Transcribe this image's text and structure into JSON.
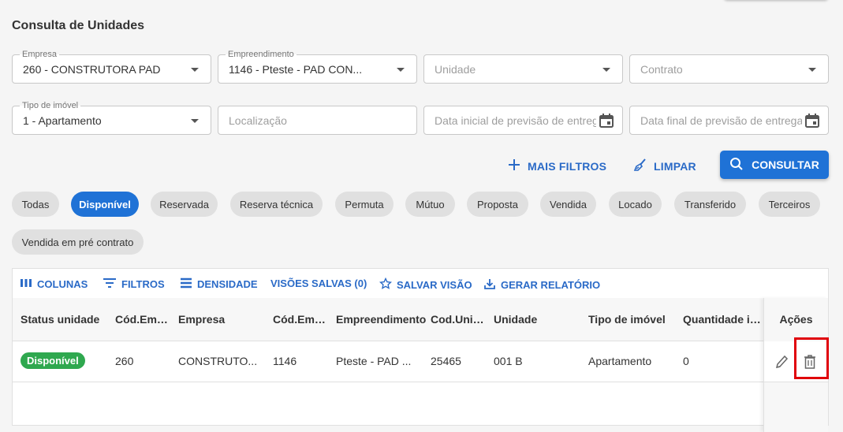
{
  "page": {
    "title": "Consulta de Unidades"
  },
  "filters": {
    "empresa": {
      "label": "Empresa",
      "value": "260 - CONSTRUTORA PAD"
    },
    "empreendimento": {
      "label": "Empreendimento",
      "value": "1146 - Pteste - PAD CON..."
    },
    "unidade": {
      "placeholder": "Unidade"
    },
    "contrato": {
      "placeholder": "Contrato"
    },
    "tipo_imovel": {
      "label": "Tipo de imóvel",
      "value": "1 - Apartamento"
    },
    "localizacao": {
      "placeholder": "Localização"
    },
    "data_inicial": {
      "placeholder": "Data inicial de previsão de entrega"
    },
    "data_final": {
      "placeholder": "Data final de previsão de entrega"
    }
  },
  "actions": {
    "more_filters": "MAIS FILTROS",
    "clear": "LIMPAR",
    "search": "CONSULTAR"
  },
  "status_chips": [
    "Todas",
    "Disponível",
    "Reservada",
    "Reserva técnica",
    "Permuta",
    "Mútuo",
    "Proposta",
    "Vendida",
    "Locado",
    "Transferido",
    "Terceiros",
    "Vendida em pré contrato"
  ],
  "active_chip": "Disponível",
  "toolbar": {
    "columns": "COLUNAS",
    "filters": "FILTROS",
    "density": "DENSIDADE",
    "saved_views": "VISÕES SALVAS (0)",
    "save_view": "SALVAR VISÃO",
    "report": "GERAR RELATÓRIO"
  },
  "table": {
    "headers": [
      "Status unidade",
      "Cód.Emp...",
      "Empresa",
      "Cód.Emp...",
      "Empreendimento",
      "Cod.Unid...",
      "Unidade",
      "Tipo de imóvel",
      "Quantidade ind...",
      "Ações"
    ],
    "rows": [
      {
        "status": "Disponível",
        "cod_emp": "260",
        "empresa": "CONSTRUTO...",
        "cod_empreend": "1146",
        "empreendimento": "Pteste - PAD ...",
        "cod_unid": "25465",
        "unidade": "001 B",
        "tipo": "Apartamento",
        "quantidade": "0"
      }
    ]
  },
  "colors": {
    "primary": "#1f72d6",
    "success": "#2fa84f",
    "highlight": "#e0000a"
  }
}
